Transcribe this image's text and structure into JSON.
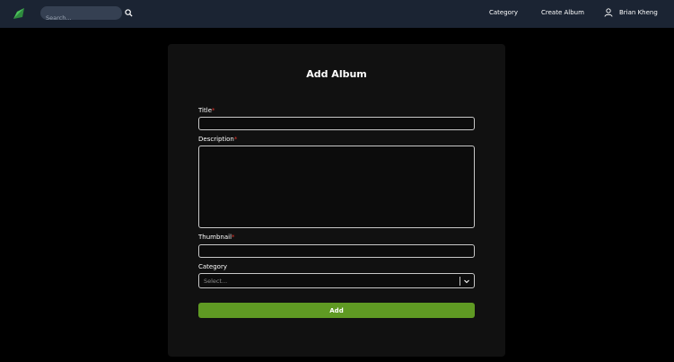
{
  "navbar": {
    "logo_icon": "leaf-logo-icon",
    "search_placeholder": "Search...",
    "search_icon": "search-icon",
    "links": [
      {
        "label": "Category"
      },
      {
        "label": "Create Album"
      }
    ],
    "user_icon": "user-icon",
    "user_name": "Brian Kheng"
  },
  "form": {
    "title": "Add Album",
    "fields": {
      "title": {
        "label": "Title",
        "required_mark": "*",
        "value": ""
      },
      "description": {
        "label": "Description",
        "required_mark": "*",
        "value": ""
      },
      "thumbnail": {
        "label": "Thumbnail",
        "required_mark": "*",
        "value": ""
      },
      "category": {
        "label": "Category",
        "placeholder": "Select..."
      }
    },
    "submit_label": "Add"
  },
  "colors": {
    "navbar_bg": "#1b2433",
    "page_bg": "#000000",
    "card_bg": "#111111",
    "accent_green": "#5f9a23",
    "required_red": "#e0342c"
  }
}
